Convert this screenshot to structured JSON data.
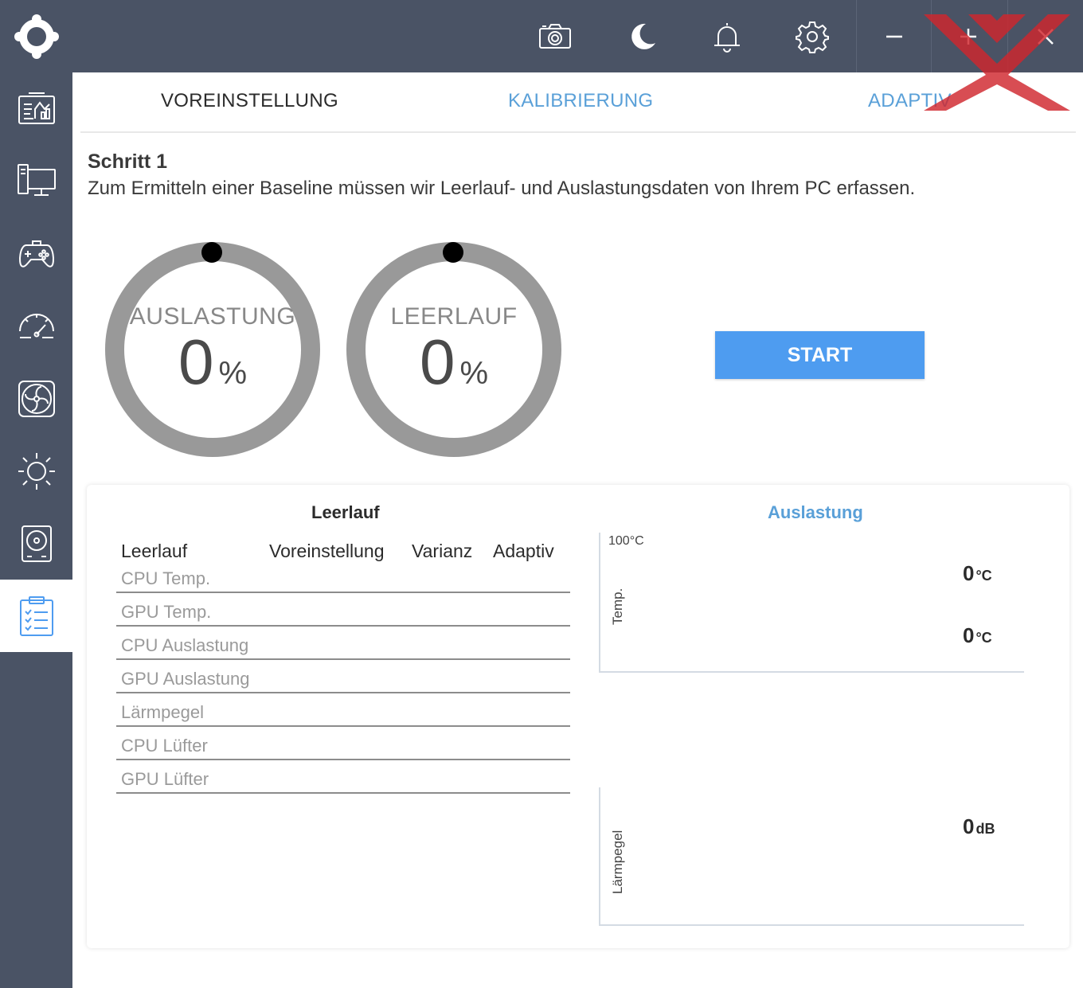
{
  "titlebar": {
    "icons": [
      "camera-icon",
      "moon-icon",
      "bell-icon",
      "gear-icon"
    ],
    "window_controls": [
      "minimize",
      "maximize",
      "close"
    ]
  },
  "sidebar": {
    "items": [
      {
        "icon": "dashboard-icon"
      },
      {
        "icon": "monitor-icon"
      },
      {
        "icon": "gamepad-icon"
      },
      {
        "icon": "speedometer-icon"
      },
      {
        "icon": "fan-icon"
      },
      {
        "icon": "sun-icon"
      },
      {
        "icon": "drive-icon"
      },
      {
        "icon": "clipboard-icon",
        "active": true
      }
    ]
  },
  "tabs": [
    {
      "label": "VOREINSTELLUNG",
      "active": true
    },
    {
      "label": "KALIBRIERUNG",
      "active": false
    },
    {
      "label": "ADAPTIV",
      "active": false
    }
  ],
  "step": {
    "title": "Schritt 1",
    "description": "Zum Ermitteln einer Baseline müssen wir Leerlauf- und Auslastungsdaten von Ihrem PC erfassen."
  },
  "gauges": [
    {
      "label": "AUSLASTUNG",
      "value": "0",
      "unit": "%"
    },
    {
      "label": "LEERLAUF",
      "value": "0",
      "unit": "%"
    }
  ],
  "start_label": "START",
  "results": {
    "left_title": "Leerlauf",
    "right_title": "Auslastung",
    "columns": [
      "Leerlauf",
      "Voreinstellung",
      "Varianz",
      "Adaptiv"
    ],
    "rows": [
      "CPU Temp.",
      "GPU Temp.",
      "CPU Auslastung",
      "GPU Auslastung",
      "Lärmpegel",
      "CPU Lüfter",
      "GPU Lüfter"
    ]
  },
  "charts": {
    "temp": {
      "axis_top": "100°C",
      "ylabel": "Temp.",
      "readings": [
        {
          "value": "0",
          "unit": "°C"
        },
        {
          "value": "0",
          "unit": "°C"
        }
      ]
    },
    "noise": {
      "ylabel": "Lärmpegel",
      "readings": [
        {
          "value": "0",
          "unit": "dB"
        }
      ]
    }
  },
  "colors": {
    "chrome": "#4a5365",
    "accent": "#4e9cf0",
    "link": "#5aa0d8",
    "watermark": "#d0262d"
  }
}
